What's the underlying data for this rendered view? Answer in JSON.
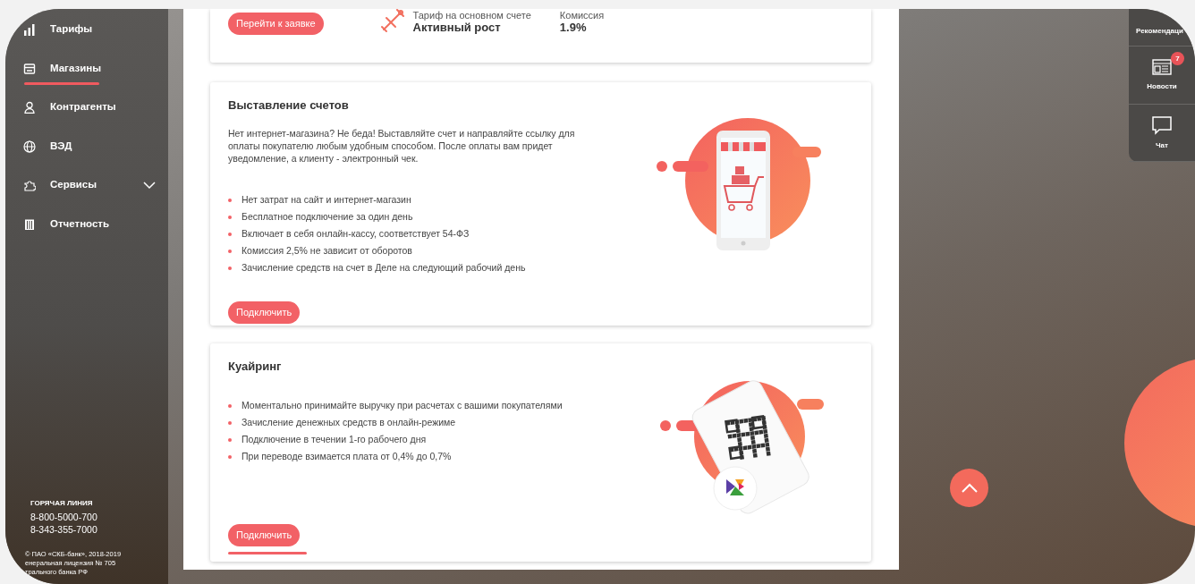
{
  "sidebar": {
    "items": [
      {
        "label": "Тарифы",
        "selected": false,
        "submenu": false
      },
      {
        "label": "Магазины",
        "selected": true,
        "submenu": false
      },
      {
        "label": "Контрагенты",
        "selected": false,
        "submenu": false
      },
      {
        "label": "ВЭД",
        "selected": false,
        "submenu": false
      },
      {
        "label": "Сервисы",
        "selected": false,
        "submenu": true
      },
      {
        "label": "Отчетность",
        "selected": false,
        "submenu": false
      }
    ],
    "hotline": {
      "title": "ГОРЯЧАЯ ЛИНИЯ",
      "phones": [
        "8-800-5000-700",
        "8-343-355-7000"
      ]
    },
    "copyright": [
      "© ПАО «СКБ-банк», 2018-2019",
      "енеральная лицензия № 705",
      "трального банка РФ"
    ]
  },
  "top_card": {
    "button": "Перейти к заявке",
    "tariff_label": "Тариф на основном счете",
    "tariff": "Активный рост",
    "commission_label": "Комиссия",
    "commission": "1.9%"
  },
  "offers": [
    {
      "kind": "shop",
      "title": "Выставление счетов",
      "description": "Нет интернет-магазина? Не беда! Выставляйте счет и направляйте ссылку для оплаты покупателю любым удобным способом. После оплаты вам придет уведомление, а клиенту - электронный чек.",
      "bullets": [
        "Нет затрат на сайт и интернет-магазин",
        "Бесплатное подключение за один день",
        "Включает в себя онлайн-кассу, соответствует 54-ФЗ",
        "Комиссия 2,5% не зависит от оборотов",
        "Зачисление средств на счет в Деле на следующий рабочий день"
      ],
      "button": "Подключить"
    },
    {
      "kind": "qr",
      "title": "Куайринг",
      "bullets": [
        "Моментально принимайте выручку при расчетах с вашими покупателями",
        "Зачисление денежных средств в онлайн-режиме",
        "Подключение в течении 1-го рабочего дня",
        "При переводе взимается плата от 0,4% до 0,7%"
      ],
      "button": "Подключить"
    }
  ],
  "right_panel": {
    "items": [
      {
        "label": "Рекомендаци"
      },
      {
        "label": "Новости",
        "badge": "7"
      },
      {
        "label": "Чат"
      }
    ]
  }
}
